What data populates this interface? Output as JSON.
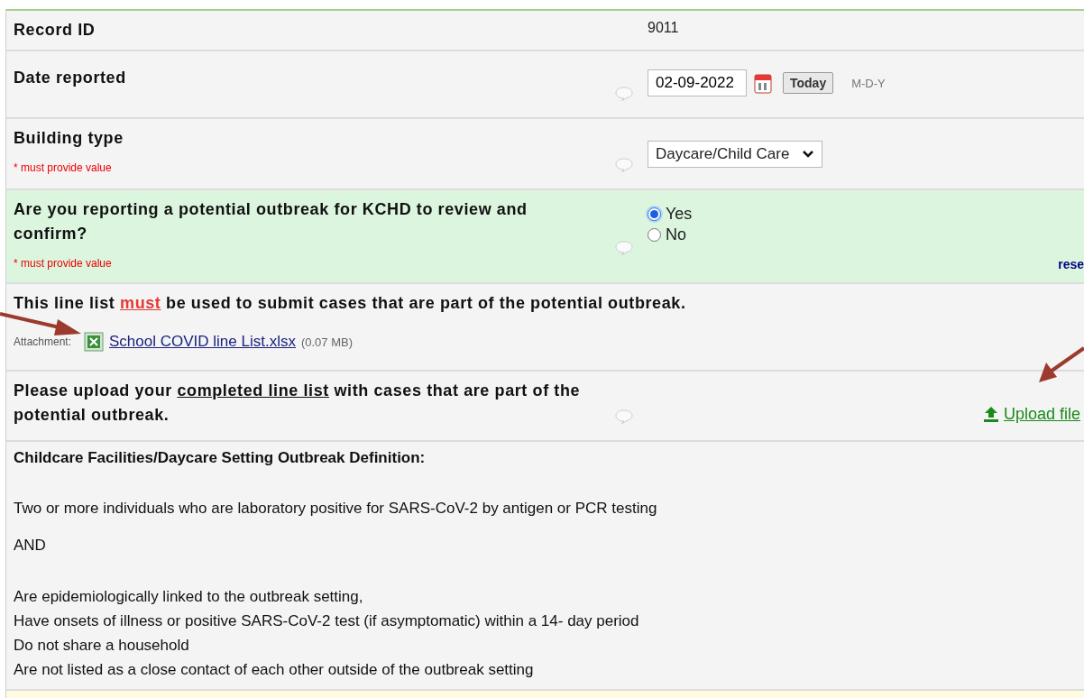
{
  "record": {
    "label": "Record ID",
    "value": "9011"
  },
  "date_field": {
    "label": "Date reported",
    "value": "02-09-2022",
    "button": "Today",
    "format": "M-D-Y"
  },
  "building_type": {
    "label": "Building type",
    "required_note": "* must provide value",
    "value": "Daycare/Child Care"
  },
  "outbreak_question": {
    "label": "Are you reporting a potential outbreak for KCHD to review and confirm?",
    "required_note": "* must provide value",
    "options": [
      {
        "label": "Yes",
        "selected": true
      },
      {
        "label": "No",
        "selected": false
      }
    ],
    "reset": "rese"
  },
  "line_list_note": {
    "parts": [
      {
        "text": "This line list ",
        "underline": false
      },
      {
        "text": "must",
        "underline": true,
        "color": "#e53935"
      },
      {
        "text": " be used to submit cases that are part of the potential outbreak.",
        "underline": false
      }
    ],
    "attachment_label": "Attachment:",
    "attachment": "School COVID line List.xlsx",
    "size": "(0.07 MB)"
  },
  "upload": {
    "parts": [
      {
        "text": "Please upload your ",
        "underline": false
      },
      {
        "text": "completed line list",
        "underline": true
      },
      {
        "text": " with cases that are part of the potential outbreak.",
        "underline": false
      }
    ],
    "link": "Upload file"
  },
  "definition": {
    "title": "Childcare Facilities/Daycare Setting Outbreak Definition:",
    "paragraphs": [
      {
        "lines": [
          "Two or more individuals who are laboratory positive for SARS-CoV-2 by antigen or PCR testing"
        ]
      },
      {
        "lines": [
          "AND"
        ]
      },
      {
        "lines": [
          "Are epidemiologically linked to the outbreak setting,",
          "Have onsets of illness or positive SARS-CoV-2 test (if asymptomatic) within a 14- day period",
          "Do not share a household",
          "Are not listed as a close contact of each other outside of the outbreak setting"
        ]
      }
    ]
  }
}
